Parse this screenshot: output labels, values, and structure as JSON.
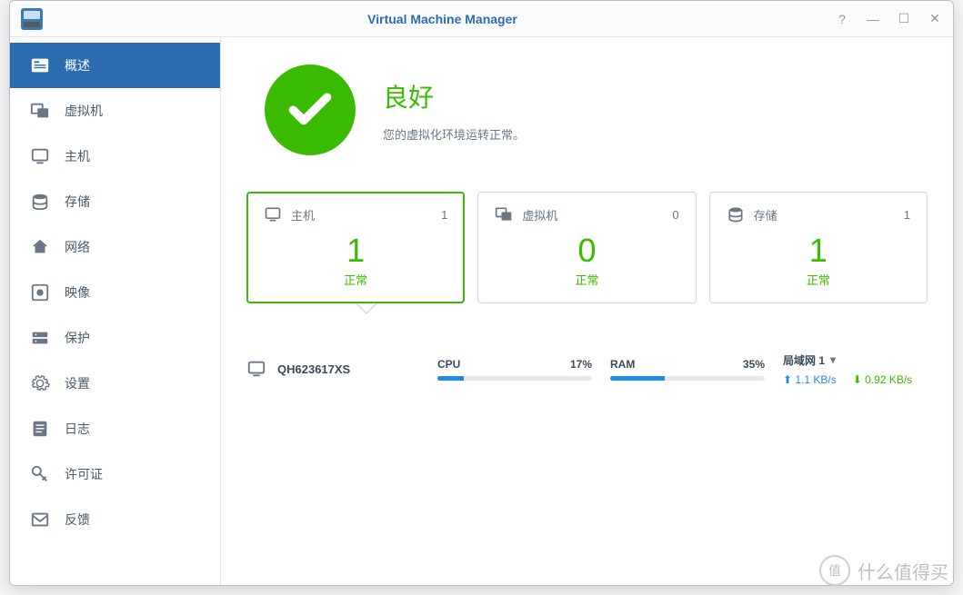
{
  "window": {
    "title": "Virtual Machine Manager"
  },
  "sidebar": {
    "items": [
      {
        "label": "概述"
      },
      {
        "label": "虚拟机"
      },
      {
        "label": "主机"
      },
      {
        "label": "存储"
      },
      {
        "label": "网络"
      },
      {
        "label": "映像"
      },
      {
        "label": "保护"
      },
      {
        "label": "设置"
      },
      {
        "label": "日志"
      },
      {
        "label": "许可证"
      },
      {
        "label": "反馈"
      }
    ]
  },
  "status": {
    "title": "良好",
    "subtitle": "您的虚拟化环境运转正常。"
  },
  "cards": {
    "host": {
      "title": "主机",
      "count": "1",
      "value": "1",
      "status": "正常"
    },
    "vm": {
      "title": "虚拟机",
      "count": "0",
      "value": "0",
      "status": "正常"
    },
    "store": {
      "title": "存储",
      "count": "1",
      "value": "1",
      "status": "正常"
    }
  },
  "host_detail": {
    "name": "QH623617XS",
    "cpu": {
      "label": "CPU",
      "value": "17%",
      "pct": 17
    },
    "ram": {
      "label": "RAM",
      "value": "35%",
      "pct": 35
    },
    "network": {
      "label": "局域网 1",
      "up": "1.1 KB/s",
      "down": "0.92 KB/s"
    }
  },
  "watermark": {
    "badge": "值",
    "text": "什么值得买"
  }
}
